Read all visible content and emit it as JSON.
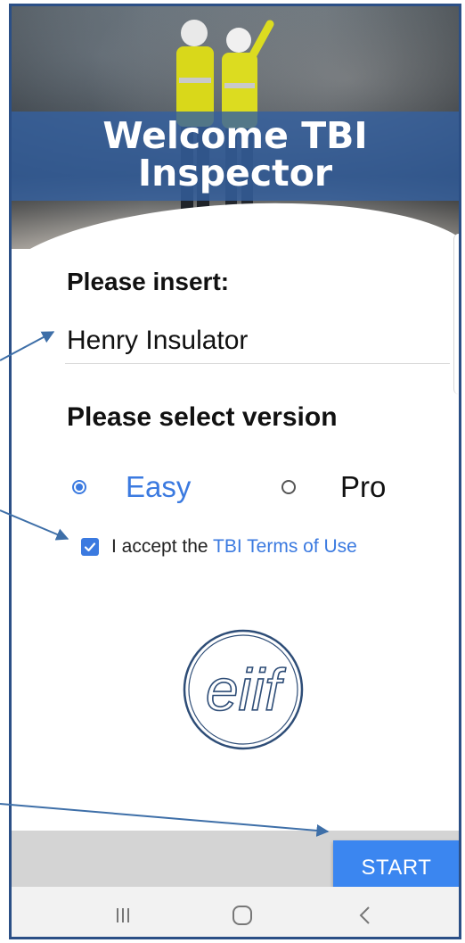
{
  "hero": {
    "title_line1": "Welcome TBI",
    "title_line2": "Inspector"
  },
  "form": {
    "insert_label": "Please insert:",
    "name_value": "Henry Insulator",
    "version_label": "Please select version",
    "versions": [
      {
        "label": "Easy",
        "selected": true
      },
      {
        "label": "Pro",
        "selected": false
      }
    ],
    "terms_prefix": "I accept the ",
    "terms_link": "TBI Terms of Use",
    "terms_checked": true
  },
  "logo_text": "eiif",
  "actions": {
    "start_label": "START"
  },
  "colors": {
    "accent": "#3b7ae0",
    "frame": "#2b4f86",
    "hero_band": "#3460a0"
  },
  "nav": {
    "recents_icon": "recents-icon",
    "home_icon": "home-icon",
    "back_icon": "back-icon"
  }
}
